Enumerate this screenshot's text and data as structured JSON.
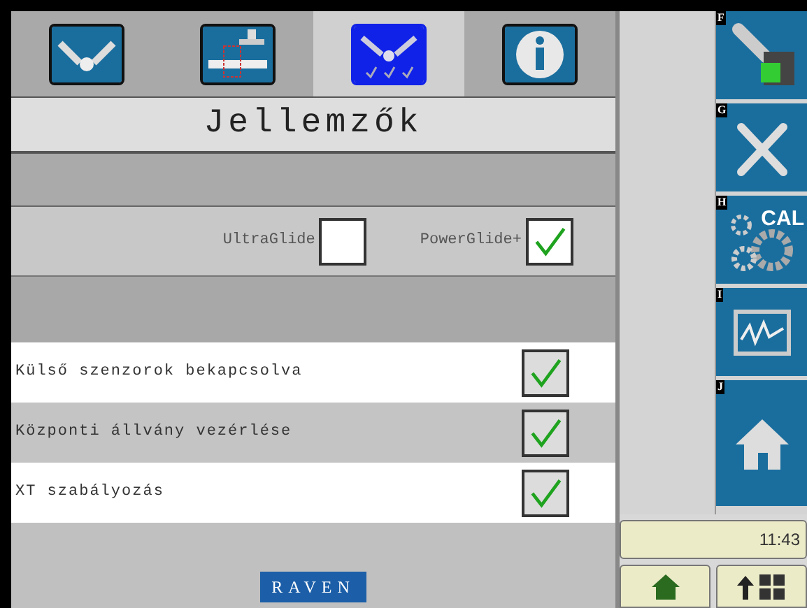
{
  "tabs": [
    {
      "kind": "boom",
      "selected": false
    },
    {
      "kind": "sensor",
      "selected": false
    },
    {
      "kind": "features",
      "selected": true
    },
    {
      "kind": "info",
      "selected": false
    }
  ],
  "title": "Jellemzők",
  "options": [
    {
      "label": "UltraGlide",
      "checked": false
    },
    {
      "label": "PowerGlide+",
      "checked": true
    }
  ],
  "features": [
    {
      "label": "Külső szenzorok bekapcsolva",
      "checked": true
    },
    {
      "label": "Központi állvány vezérlése",
      "checked": true
    },
    {
      "label": "XT szabályozás",
      "checked": true
    }
  ],
  "logo": "RAVEN",
  "softkeys": [
    {
      "key": "F",
      "kind": "switch"
    },
    {
      "key": "G",
      "kind": "tools"
    },
    {
      "key": "H",
      "kind": "calibration",
      "text": "CAL"
    },
    {
      "key": "I",
      "kind": "diagnostics"
    },
    {
      "key": "J",
      "kind": "home"
    }
  ],
  "clock": "11:43",
  "bottom_buttons": [
    {
      "kind": "home"
    },
    {
      "kind": "up-grid"
    }
  ]
}
